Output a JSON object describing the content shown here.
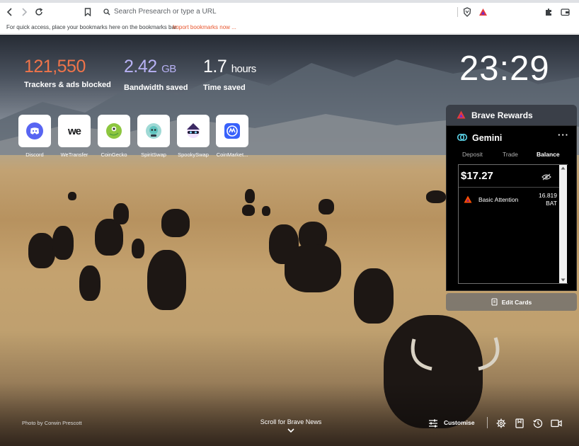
{
  "browser": {
    "omnibox_placeholder": "Search Presearch or type a URL",
    "bookmarks_message": "For quick access, place your bookmarks here on the bookmarks bar.",
    "import_link": "Import bookmarks now ..."
  },
  "stats": {
    "trackers": {
      "value": "121,550",
      "label": "Trackers & ads blocked",
      "color": "#f0744a"
    },
    "bandwidth": {
      "value": "2.42",
      "unit": "GB",
      "label": "Bandwidth saved",
      "color": "#b8b2f5"
    },
    "time": {
      "value": "1.7",
      "unit": "hours",
      "label": "Time saved"
    }
  },
  "clock": "23:29",
  "top_sites": [
    {
      "name": "Discord",
      "icon": "discord-icon",
      "color": "#5865f2"
    },
    {
      "name": "WeTransfer",
      "icon": "wetransfer-icon",
      "color": "#17181a"
    },
    {
      "name": "CoinGecko",
      "icon": "coingecko-icon",
      "color": "#8dc63f"
    },
    {
      "name": "SpiritSwap",
      "icon": "spiritswap-icon",
      "color": "#60c4bf"
    },
    {
      "name": "SpookySwap",
      "icon": "spookyswap-icon",
      "color": "#6665dd"
    },
    {
      "name": "CoinMarket...",
      "icon": "coinmarketcap-icon",
      "color": "#3861fb"
    }
  ],
  "rewards": {
    "title": "Brave Rewards",
    "provider": "Gemini",
    "tabs": [
      "Deposit",
      "Trade",
      "Balance"
    ],
    "active_tab": "Balance",
    "balance": "$17.27",
    "asset": {
      "name": "Basic Attention",
      "amount": "16.819",
      "symbol": "BAT"
    },
    "edit_cards": "Edit Cards"
  },
  "footer": {
    "photo_credit": "Photo by Corwin Prescott",
    "news": "Scroll for Brave News",
    "customise": "Customise"
  }
}
